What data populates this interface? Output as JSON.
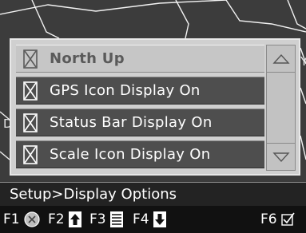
{
  "map": {
    "fragments": [
      "Y",
      "D",
      "Y"
    ]
  },
  "dialog": {
    "options": [
      {
        "label": "North Up",
        "checked": true,
        "selected": true
      },
      {
        "label": "GPS Icon Display On",
        "checked": true,
        "selected": false
      },
      {
        "label": "Status Bar Display On",
        "checked": true,
        "selected": false
      },
      {
        "label": "Scale Icon Display On",
        "checked": true,
        "selected": false
      }
    ],
    "scroll_up_icon": "triangle-up-outline-icon",
    "scroll_down_icon": "triangle-down-outline-icon"
  },
  "breadcrumb": "Setup>Display Options",
  "fkeys": [
    {
      "label": "F1",
      "icon": "cancel-circle-icon"
    },
    {
      "label": "F2",
      "icon": "page-up-icon"
    },
    {
      "label": "F3",
      "icon": "list-icon"
    },
    {
      "label": "F4",
      "icon": "page-down-icon"
    },
    {
      "label": "F6",
      "icon": "checkbox-icon"
    }
  ],
  "colors": {
    "dialog_bg": "#d0d0d0",
    "row_bg": "#4e4e4e",
    "row_selected_bg": "#c6c6c6",
    "breadcrumb_bg": "#232323",
    "fkey_bg": "#111111"
  }
}
